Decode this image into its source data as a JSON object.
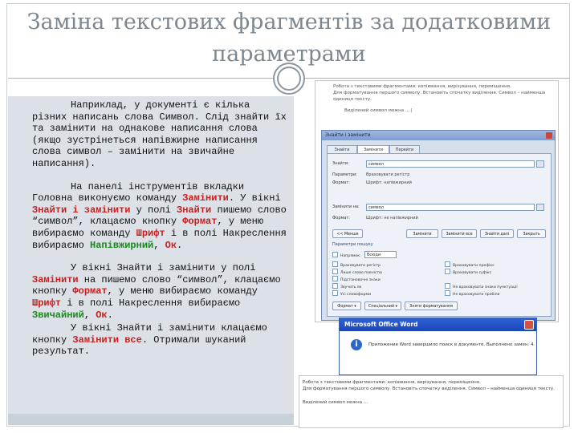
{
  "slide": {
    "title": "Заміна текстових фрагментів за додатковими параметрами"
  },
  "body": {
    "p1": "Наприклад, у документі є кілька різних написань слова Символ. Слід знайти їх та замінити на однакове написання слова (якщо зустрінеться напівжирне написання слова символ – замінити на звичайне написання).",
    "p2": {
      "t1": "На панелі інструментів вкладки Головна виконуємо команду ",
      "zaminyty": "Замінити",
      "t2": ". У вікні ",
      "znaity_zaminyty": "Знайти і замінити",
      "t3": " у полі ",
      "znaity": "Знайти",
      "t4": " пишемо слово “символ”, клацаємо кнопку ",
      "format": "Формат",
      "t5": ", у меню вибираємо команду ",
      "shryft": "Шрифт",
      "t6": " і в полі Накреслення вибираємо ",
      "napivzhyrnyi": "Напівжирний",
      "t7": ", ",
      "ok": "Ок",
      "t8": "."
    },
    "p3": {
      "t1": "У вікні Знайти і замінити  у полі ",
      "zaminyty": "Замінити",
      "t2": " на пишемо слово “символ”, клацаємо кнопку ",
      "format": "Формат",
      "t3": ", у меню вибираємо команду ",
      "shryft": "Шрифт",
      "t4": " і в полі Накреслення вибираємо ",
      "zvychainyi": "Звичайний",
      "t5": ", ",
      "ok": "Ок",
      "t6": "."
    },
    "p4": {
      "t1": "У вікні Знайти і замінити клацаємо кнопку ",
      "zaminyty_vse": "Замінити все",
      "t2": ". Отримали шуканий результат."
    }
  },
  "shot1": {
    "line1": "Робота з текстовими фрагментами: копіювання, вирізування, переміщення.",
    "line2": "Для форматування першого символу. Встановіть спочатку виділення. Символ – найменша одиниця тексту.",
    "line3": "Виділений символ можна ... |"
  },
  "dialog": {
    "title": "Знайти і замінити",
    "tabs": [
      "Знайти",
      "Замінити",
      "Перейти"
    ],
    "find_label": "Знайти:",
    "find_value": "символ",
    "find_params_label": "Параметри:",
    "find_params_value": "Враховувати регістр",
    "find_format_label": "Формат:",
    "find_format_value": "Шрифт: напівжирний",
    "replace_label": "Замінити на:",
    "replace_value": "символ",
    "replace_format_label": "Формат:",
    "replace_format_value": "Шрифт: не напівжирний",
    "buttons": [
      "<< Менше",
      "Замінити",
      "Замінити все",
      "Знайти далі",
      "Закрыть"
    ],
    "options_header": "Параметри пошуку",
    "direction_label": "Напрямок:",
    "direction_value": "Всюди",
    "checkboxes": [
      "Враховувати регістр",
      "Лише слово повністю",
      "Підстановочні знаки",
      "Звучить як",
      "Усі словоформи",
      "Враховувати префікс",
      "Враховувати суфікс",
      "Не враховувати знаки пунктуації",
      "Не враховувати пробіли"
    ],
    "bottom_buttons": [
      "Формат ▾",
      "Спеціальний ▾",
      "Зняти форматування"
    ]
  },
  "shot2": {
    "title": "Microsoft Office Word",
    "message": "Приложение Word завершило поиск в документе. Выполнено замен: 4."
  },
  "shot3": {
    "line1": "Робота з текстовими фрагментами: копіювання, вирізування, переміщення.",
    "line2": "Для форматування першого символу. Встановіть спочатку виділення. Символ – найменша одиниця тексту.",
    "line3": "Виділений символ можна ..."
  }
}
